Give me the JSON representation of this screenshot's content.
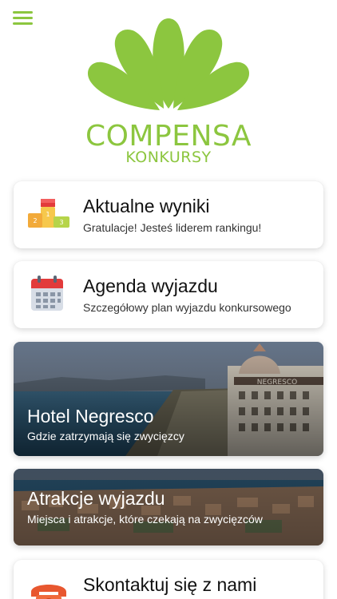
{
  "brand": {
    "name": "COMPENSA",
    "subtitle": "KONKURSY",
    "color": "#8cc63f"
  },
  "menu": {
    "icon": "hamburger-menu-icon"
  },
  "cards": [
    {
      "title": "Aktualne wyniki",
      "subtitle": "Gratulacje! Jesteś liderem rankingu!",
      "icon": "podium-icon"
    },
    {
      "title": "Agenda wyjazdu",
      "subtitle": "Szczegółowy plan wyjazdu konkursowego",
      "icon": "calendar-icon"
    },
    {
      "title": "Hotel Negresco",
      "subtitle": "Gdzie zatrzymają się zwycięzcy",
      "icon": "hotel-photo"
    },
    {
      "title": "Atrakcje wyjazdu",
      "subtitle": "Miejsca i atrakcje, które czekają na zwycięzców",
      "icon": "city-photo"
    },
    {
      "title": "Skontaktuj się z nami",
      "subtitle": "",
      "icon": "phone-icon"
    }
  ]
}
